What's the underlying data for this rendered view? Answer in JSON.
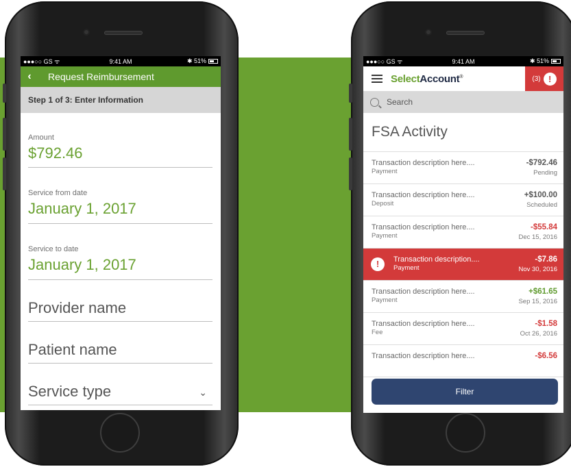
{
  "colors": {
    "brand_green": "#6aa131",
    "alert_red": "#d33a3a",
    "navy": "#2f4570",
    "negative": "#d33a3a",
    "positive": "#5f9a2e",
    "neutral": "#555555"
  },
  "status_bar": {
    "carrier": "●●●○○ GS ᯤ",
    "time": "9:41 AM",
    "battery": "✱ 51%"
  },
  "left_screen": {
    "header_title": "Request Reimbursement",
    "back_icon": "chevron-left-icon",
    "step": "Step 1 of 3: Enter Information",
    "fields": [
      {
        "label": "Amount",
        "value": "$792.46"
      },
      {
        "label": "Service from date",
        "value": "January 1, 2017"
      },
      {
        "label": "Service to date",
        "value": "January 1, 2017"
      }
    ],
    "placeholders": {
      "provider": "Provider name",
      "patient": "Patient name",
      "service_type": "Service type"
    }
  },
  "right_screen": {
    "logo": {
      "part1": "Select",
      "part2": "Account",
      "mark": "®"
    },
    "alert_count": "(3)",
    "alert_symbol": "!",
    "search_placeholder": "Search",
    "page_title": "FSA Activity",
    "transactions": [
      {
        "description": "Transaction description here....",
        "type": "Payment",
        "amount": "-$792.46",
        "meta": "Pending",
        "tone": "neutral"
      },
      {
        "description": "Transaction description here....",
        "type": "Deposit",
        "amount": "+$100.00",
        "meta": "Scheduled",
        "tone": "neutral"
      },
      {
        "description": "Transaction description here....",
        "type": "Payment",
        "amount": "-$55.84",
        "meta": "Dec 15, 2016",
        "tone": "negative"
      },
      {
        "description": "Transaction description....",
        "type": "Payment",
        "amount": "-$7.86",
        "meta": "Nov 30, 2016",
        "tone": "alert"
      },
      {
        "description": "Transaction description here....",
        "type": "Payment",
        "amount": "+$61.65",
        "meta": "Sep 15, 2016",
        "tone": "positive"
      },
      {
        "description": "Transaction description here....",
        "type": "Fee",
        "amount": "-$1.58",
        "meta": "Oct 26, 2016",
        "tone": "negative"
      },
      {
        "description": "Transaction description here....",
        "type": "",
        "amount": "-$6.56",
        "meta": "",
        "tone": "negative"
      }
    ],
    "filter_label": "Filter"
  }
}
